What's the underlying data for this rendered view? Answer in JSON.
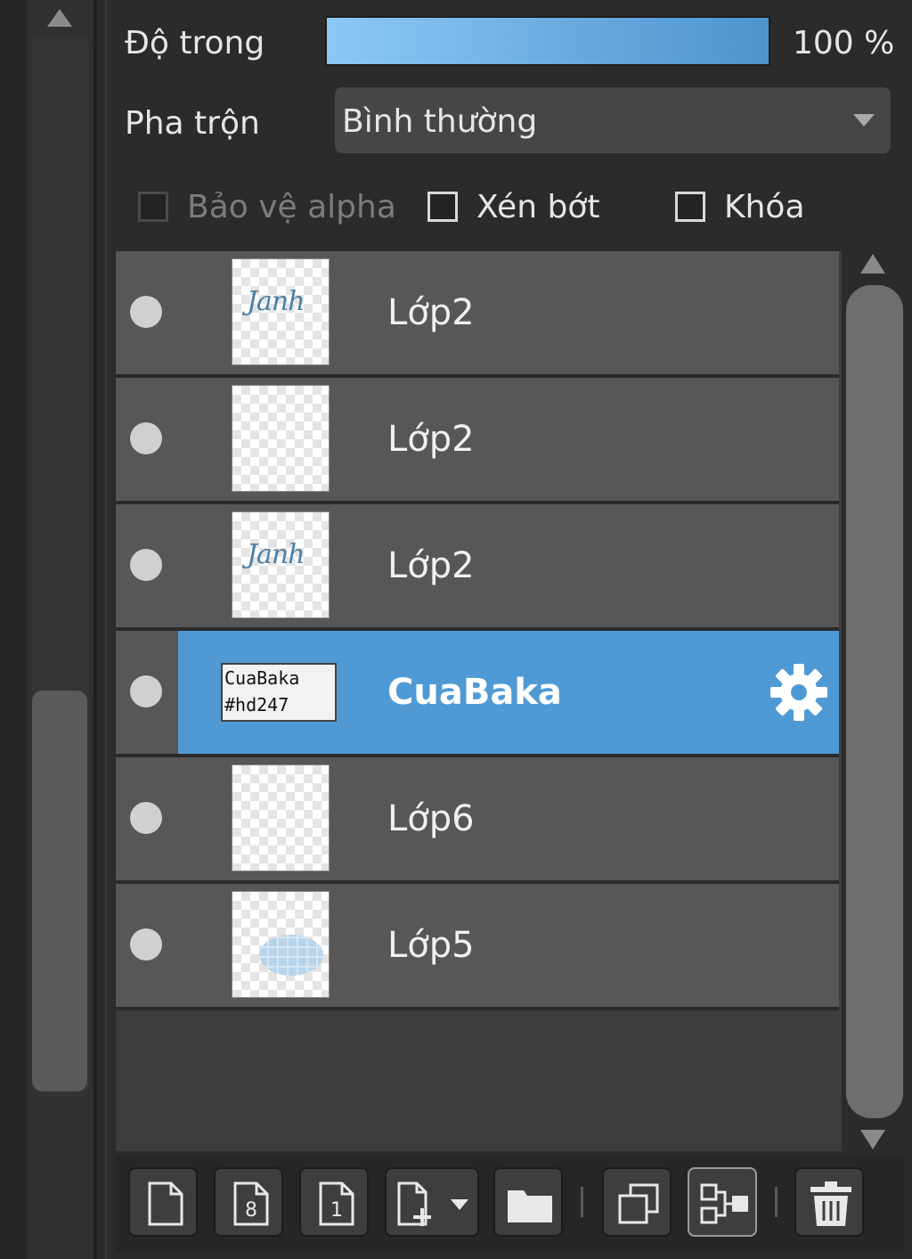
{
  "properties": {
    "opacity_label": "Độ trong",
    "opacity_value": "100 %",
    "opacity_fraction": 1.0,
    "blend_label": "Pha trộn",
    "blend_value": "Bình thường",
    "protect_alpha_label": "Bảo vệ alpha",
    "clip_label": "Xén bớt",
    "lock_label": "Khóa"
  },
  "layers": [
    {
      "name": "Lớp2",
      "thumb": "script",
      "thumb_text": "Janh",
      "selected": false
    },
    {
      "name": "Lớp2",
      "thumb": "white-script",
      "thumb_text": "",
      "selected": false
    },
    {
      "name": "Lớp2",
      "thumb": "script",
      "thumb_text": "Janh",
      "selected": false
    },
    {
      "name": "CuaBaka",
      "thumb": "text-folder",
      "thumb_text": "CuaBaka\n#hd247",
      "selected": true
    },
    {
      "name": "Lớp6",
      "thumb": "blank",
      "thumb_text": "",
      "selected": false
    },
    {
      "name": "Lớp5",
      "thumb": "ellipse",
      "thumb_text": "",
      "selected": false
    }
  ],
  "layer_thumb_lines": [
    "CuaBaka",
    "#hd247"
  ],
  "toolbar": {
    "buttons": [
      "new-layer-icon",
      "new-8bit-layer-icon",
      "new-1bit-layer-icon",
      "add-layer-dropdown-icon",
      "folder-icon",
      "duplicate-icon",
      "merge-icon",
      "trash-icon"
    ]
  },
  "colors": {
    "accent": "#4f9ad4",
    "row_bg": "#575757",
    "panel_bg": "#2b2b2b"
  }
}
